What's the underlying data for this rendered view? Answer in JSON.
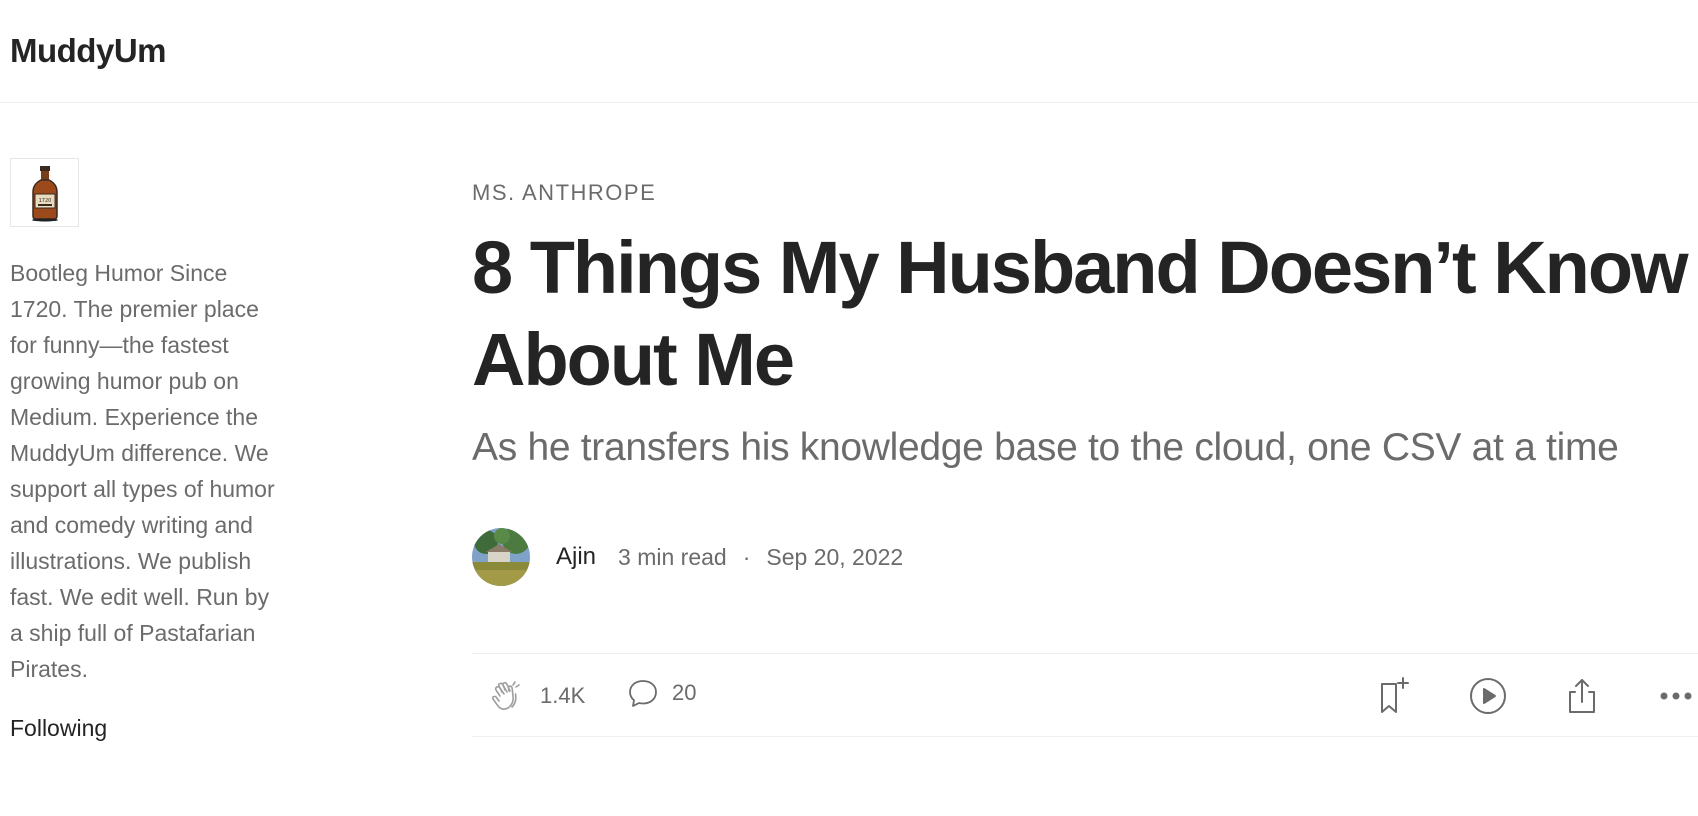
{
  "header": {
    "brand": "MuddyUm"
  },
  "sidebar": {
    "logo_icon": "bottle-logo-icon",
    "description": "Bootleg Humor Since 1720. The premier place for funny—the fastest growing humor pub on Medium. Experience the MuddyUm difference. We support all types of humor and comedy writing and illustrations. We publish fast. We edit well. Run by a ship full of Pastafarian Pirates.",
    "following_label": "Following"
  },
  "article": {
    "kicker": "MS. ANTHROPE",
    "title": "8 Things My Husband Doesn’t Know About Me",
    "subtitle": "As he transfers his knowledge base to the cloud, one CSV at a time",
    "author": "Ajin",
    "read_time": "3 min read",
    "separator": "·",
    "date": "Sep 20, 2022"
  },
  "actions": {
    "clap_icon": "clap-icon",
    "clap_count": "1.4K",
    "comment_icon": "comment-icon",
    "comment_count": "20",
    "bookmark_icon": "bookmark-add-icon",
    "listen_icon": "play-icon",
    "share_icon": "share-icon",
    "more_icon": "more-icon"
  },
  "colors": {
    "text_primary": "#242424",
    "text_secondary": "#6b6b6b",
    "divider": "#f0f0f0"
  }
}
